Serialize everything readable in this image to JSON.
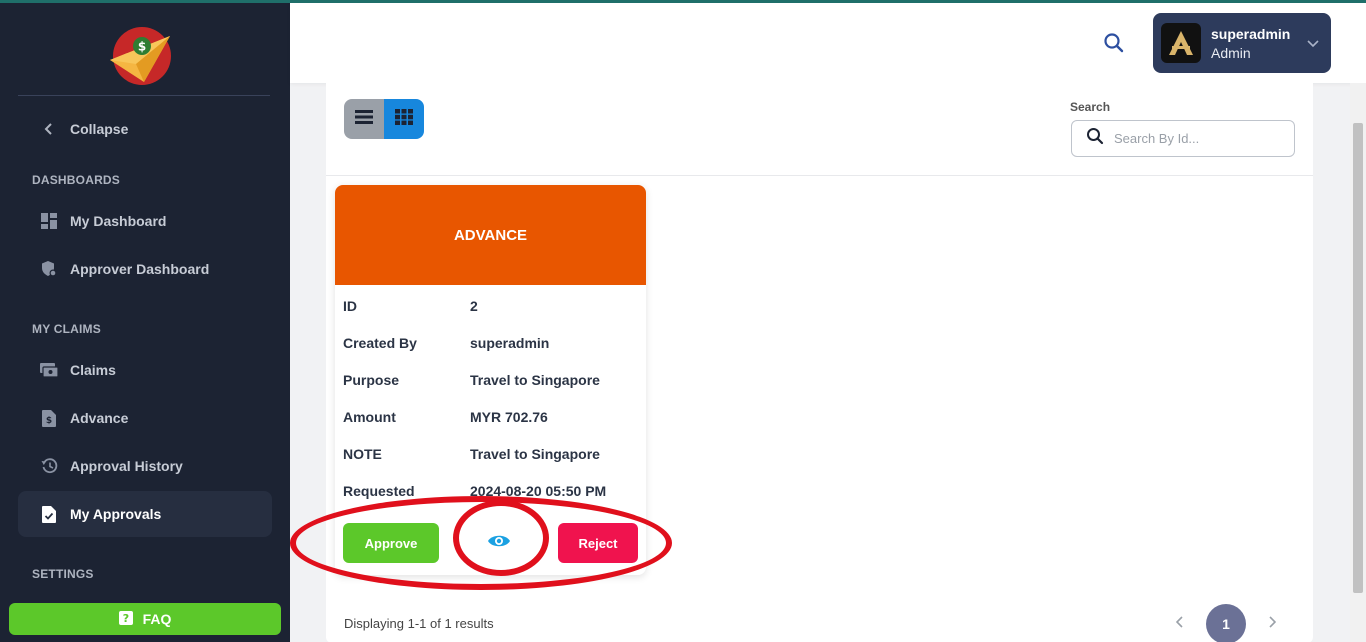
{
  "sidebar": {
    "collapse_label": "Collapse",
    "sections": {
      "dashboards": "DASHBOARDS",
      "my_claims": "MY CLAIMS",
      "settings": "SETTINGS"
    },
    "items": {
      "my_dashboard": "My Dashboard",
      "approver_dashboard": "Approver Dashboard",
      "claims": "Claims",
      "advance": "Advance",
      "approval_history": "Approval History",
      "my_approvals": "My Approvals"
    },
    "faq_label": "FAQ"
  },
  "header": {
    "user_name": "superadmin",
    "user_role": "Admin"
  },
  "toolbar": {
    "search_label": "Search",
    "search_placeholder": "Search By Id..."
  },
  "card": {
    "title": "ADVANCE",
    "rows": [
      {
        "label": "ID",
        "value": "2"
      },
      {
        "label": "Created By",
        "value": "superadmin"
      },
      {
        "label": "Purpose",
        "value": "Travel to Singapore"
      },
      {
        "label": "Amount",
        "value": "MYR 702.76"
      },
      {
        "label": "NOTE",
        "value": "Travel to Singapore"
      },
      {
        "label": "Requested",
        "value": "2024-08-20 05:50 PM"
      }
    ],
    "approve_label": "Approve",
    "reject_label": "Reject"
  },
  "footer": {
    "results_text": "Displaying 1-1 of 1 results",
    "current_page": "1"
  },
  "colors": {
    "sidebar_bg": "#1c2333",
    "card_header": "#e85600",
    "approve": "#5cc82a",
    "reject": "#f0134e",
    "view_icon": "#1ba1e2",
    "annotation": "#e0101c"
  }
}
